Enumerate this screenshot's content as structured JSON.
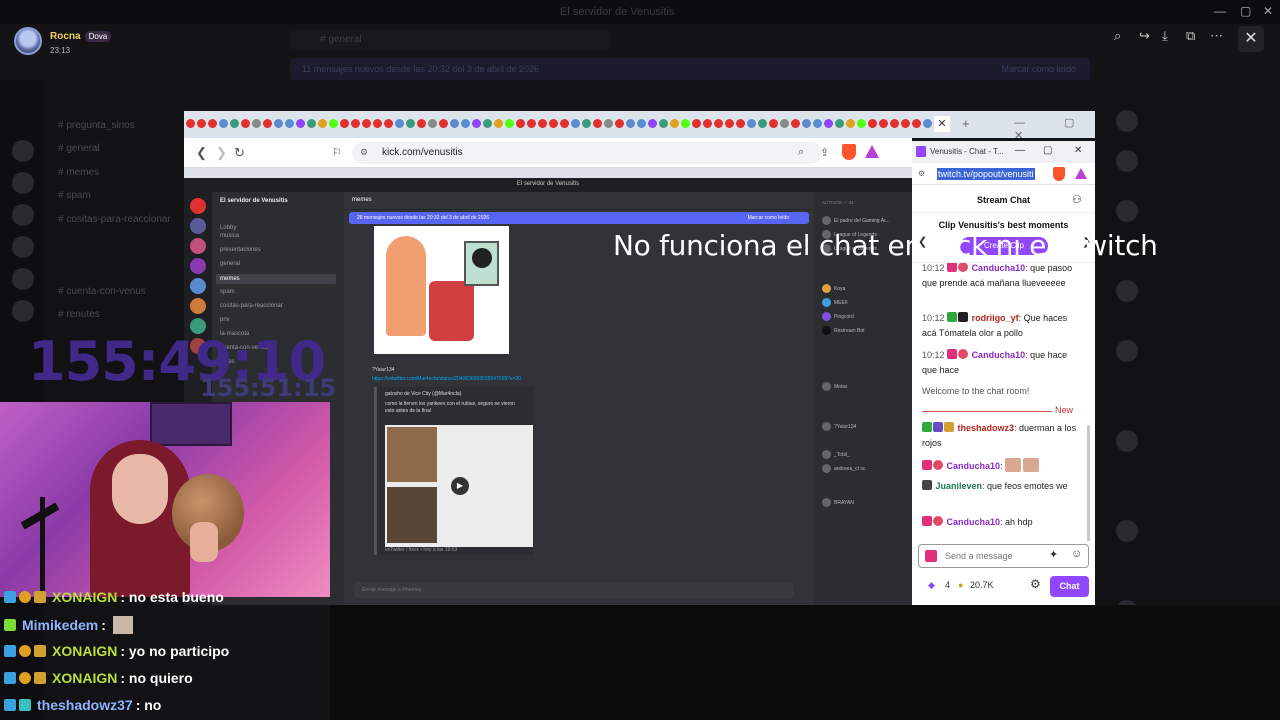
{
  "viewer": {
    "profile_name": "Rocna",
    "profile_badge": "Dova",
    "profile_time": "23:13",
    "background_title": "El servidor de Venusitis",
    "background_search": "# general",
    "background_notice": "11 mensajes nuevos desde las 20:32 del 3 de abril de 2026",
    "background_notice_right": "Marcar como leído",
    "background_channels": [
      "# pregunta_sinos",
      "# general",
      "# memes",
      "# spam",
      "# cositas-para-reaccionar",
      "# cuenta-con-venus",
      "# renutes"
    ],
    "controls": [
      "zoom-icon",
      "share-icon",
      "download-icon",
      "external-icon",
      "more-icon"
    ],
    "close_label": "✕"
  },
  "browser": {
    "url": "kick.com/venusitis",
    "tab_close": "✕",
    "tab_plus": "+",
    "ctrls": "— ▢ ✕"
  },
  "discord": {
    "window_title": "El servidor de Venusitis",
    "server_name": "El servidor de Venusitis",
    "lobby_label": "Lobby",
    "channels": [
      "musica",
      "presentaciones",
      "general",
      "memes",
      "spam",
      "cositas-para-reaccionar",
      "priv",
      "la-mascota",
      "cuenta-con-venus",
      "notes"
    ],
    "active_channel": "memes",
    "header_channel": "memes",
    "new_messages_banner": "28 mensajes nuevos desde las 20:32 del 3 de abril de 2026",
    "mark_read": "Marcar como leído",
    "msg_author": "?Yaiur134",
    "msg_link": "https://vxtwitter.com/Mar4ncfa/status/2040636002035847228?s=20",
    "embed_author": "gatosho de Vice City (@Mar4ncfa)",
    "embed_text": "como la tienen los yankees con el rubius, seguro se vieron esto antes de la final",
    "embed_footer": "vxTwitter / fixvx • hoy a las 19:53",
    "input_placeholder": "Enviar mensaje a #memes",
    "members_header": "Activos — 41",
    "members": [
      "El padre del Gaming Ar...",
      "League of Legends",
      "League of Legends",
      "Koya",
      "MEE6",
      "Pingcord",
      "Restream Bot",
      "Molas",
      "?Yaiur134",
      "_Tobii_",
      "andreea_ct sc",
      "BRAYAN"
    ]
  },
  "twitch": {
    "window_title": "Venusitis - Chat - T...",
    "url": "twitch.tv/popout/venusiti",
    "header": "Stream Chat",
    "clip_title": "Clip Venusitis's best moments",
    "clip_button": "Create Clip",
    "messages": [
      {
        "time": "10:12",
        "user": "Canducha10",
        "color": "#8a2bc0",
        "text": ": que pasoo que prende acá mañana llueveeeee"
      },
      {
        "time": "10:12",
        "user": "rodriigo_yf",
        "color": "#b0281f",
        "text": ": Que haces acá Tómatela olor a pollo"
      },
      {
        "time": "10:12",
        "user": "Canducha10",
        "color": "#8a2bc0",
        "text": ": que hace que hace"
      }
    ],
    "welcome": "Welcome to the chat room!",
    "new_label": "New",
    "after": [
      {
        "user": "theshadowz3",
        "color": "#b0281f",
        "text": ": duerman a los rojos"
      },
      {
        "user": "Canducha10",
        "color": "#8a2bc0",
        "text": ":"
      },
      {
        "user": "Juanileven",
        "color": "#1f7a4d",
        "text": ": que feos emotes we"
      },
      {
        "user": "Canducha10",
        "color": "#8a2bc0",
        "text": ": ah hdp"
      }
    ],
    "input_placeholder": "Send a message",
    "bits": "4",
    "points": "20.7K",
    "chat_button": "Chat"
  },
  "overlay": {
    "caption": "No funciona el chat en Kick ni en Twitch",
    "timer_big": "155:49:10",
    "timer_small": "155:51:15",
    "chat": [
      {
        "user": "XONAIGN",
        "color": "#b7e03a",
        "text": ": no esta bueno"
      },
      {
        "user": "Mimikedem",
        "color": "#8fb4ff",
        "text": ":"
      },
      {
        "user": "XONAIGN",
        "color": "#b7e03a",
        "text": ": yo no participo"
      },
      {
        "user": "XONAIGN",
        "color": "#b7e03a",
        "text": ": no quiero"
      },
      {
        "user": "theshadowz37",
        "color": "#8fb4ff",
        "text": ": no"
      }
    ]
  }
}
